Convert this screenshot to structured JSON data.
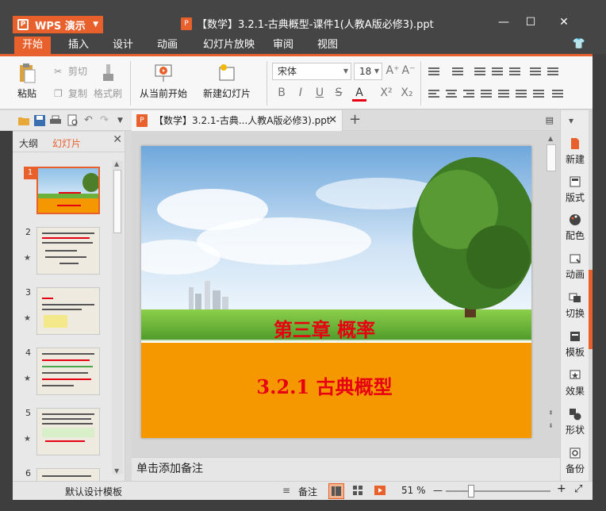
{
  "app": {
    "menu_button": "WPS 演示",
    "window_title": "【数学】3.2.1-古典概型-课件1(人教A版必修3).ppt"
  },
  "menu": {
    "tabs": [
      "开始",
      "插入",
      "设计",
      "动画",
      "幻灯片放映",
      "审阅",
      "视图"
    ],
    "active": "开始"
  },
  "ribbon": {
    "paste": "粘贴",
    "cut": "剪切",
    "copy": "复制",
    "format_painter": "格式刷",
    "from_current": "从当前开始",
    "new_slide": "新建幻灯片",
    "font_name": "宋体",
    "font_size": "18",
    "bold": "B",
    "italic": "I",
    "underline": "U",
    "strike": "S",
    "font_color": "A",
    "superscript": "X²",
    "subscript": "X₂",
    "grow_font": "A⁺",
    "shrink_font": "A⁻"
  },
  "doc_tab": {
    "label": "【数学】3.2.1-古典...人教A版必修3).ppt",
    "close": "✕",
    "new": "+"
  },
  "left_panel": {
    "tab_outline": "大纲",
    "tab_slides": "幻灯片",
    "close": "✕",
    "slides": [
      "1",
      "2",
      "3",
      "4",
      "5",
      "6"
    ]
  },
  "slide": {
    "title": "第三章 概率",
    "subtitle": "3.2.1 古典概型"
  },
  "notes": {
    "placeholder": "单击添加备注"
  },
  "task_pane": {
    "items": [
      "新建",
      "版式",
      "配色",
      "动画",
      "切换",
      "模板",
      "效果",
      "形状",
      "备份"
    ]
  },
  "status": {
    "template": "默认设计模板",
    "notes_label": "备注",
    "zoom": "51 %",
    "zoom_minus": "—",
    "zoom_plus": "+",
    "zoom_level": 0.51
  },
  "colors": {
    "accent": "#e8612c",
    "titlebar": "#454545",
    "slide_title_red": "#e60012",
    "slide_orange": "#f59800"
  }
}
